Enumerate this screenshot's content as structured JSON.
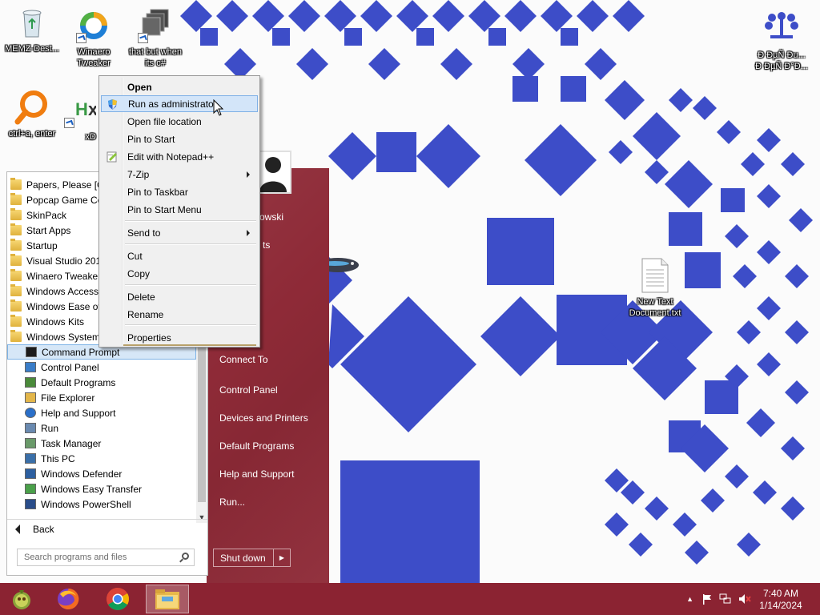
{
  "desktop": {
    "icons_left": [
      {
        "label": "MEMZ-Dest...",
        "icon": "recycle-bin-icon"
      },
      {
        "label": "Winaero Tweaker",
        "icon": "winaero-icon"
      },
      {
        "label": "that but when its c#",
        "icon": "stacked-windows-icon"
      },
      {
        "label": "ctrl+a, enter",
        "icon": "orange-magnifier-icon"
      },
      {
        "label": "xD",
        "icon": "hx-icon"
      }
    ],
    "icons_right": [
      {
        "label": "Đ ĐµÑ Đu...\nĐ ĐµÑ Đ°Đ...",
        "icon": "network-tree-icon"
      },
      {
        "label": "New Text Document.txt",
        "icon": "text-file-icon"
      }
    ]
  },
  "context_menu": {
    "items": [
      {
        "label": "Open",
        "bold": true
      },
      {
        "label": "Run as administrator",
        "hover": true,
        "icon": "uac-shield-icon"
      },
      {
        "label": "Open file location"
      },
      {
        "label": "Pin to Start"
      },
      {
        "label": "Edit with Notepad++",
        "icon": "notepad-plus-plus-icon"
      },
      {
        "label": "7-Zip",
        "submenu": true
      },
      {
        "label": "Pin to Taskbar"
      },
      {
        "label": "Pin to Start Menu"
      },
      {
        "label": "Send to",
        "submenu": true
      },
      {
        "label": "Cut"
      },
      {
        "label": "Copy"
      },
      {
        "label": "Delete"
      },
      {
        "label": "Rename"
      },
      {
        "label": "Properties"
      }
    ]
  },
  "start_menu": {
    "programs": [
      {
        "label": "Papers, Please [G",
        "type": "folder"
      },
      {
        "label": "Popcap Game Co",
        "type": "folder"
      },
      {
        "label": "SkinPack",
        "type": "folder"
      },
      {
        "label": "Start Apps",
        "type": "folder"
      },
      {
        "label": "Startup",
        "type": "folder"
      },
      {
        "label": "Visual Studio 201",
        "type": "folder"
      },
      {
        "label": "Winaero Tweaker",
        "type": "folder"
      },
      {
        "label": "Windows Accesso",
        "type": "folder"
      },
      {
        "label": "Windows Ease of",
        "type": "folder"
      },
      {
        "label": "Windows Kits",
        "type": "folder"
      },
      {
        "label": "Windows System",
        "type": "folder"
      },
      {
        "label": "Command Prompt",
        "type": "app",
        "icon": "cmd-icon",
        "selected": true
      },
      {
        "label": "Control Panel",
        "type": "app",
        "icon": "control-panel-icon"
      },
      {
        "label": "Default Programs",
        "type": "app",
        "icon": "default-programs-icon"
      },
      {
        "label": "File Explorer",
        "type": "app",
        "icon": "file-explorer-icon"
      },
      {
        "label": "Help and Support",
        "type": "app",
        "icon": "help-icon"
      },
      {
        "label": "Run",
        "type": "app",
        "icon": "run-icon"
      },
      {
        "label": "Task Manager",
        "type": "app",
        "icon": "task-manager-icon"
      },
      {
        "label": "This PC",
        "type": "app",
        "icon": "computer-icon"
      },
      {
        "label": "Windows Defender",
        "type": "app",
        "icon": "defender-icon"
      },
      {
        "label": "Windows Easy Transfer",
        "type": "app",
        "icon": "easy-transfer-icon"
      },
      {
        "label": "Windows PowerShell",
        "type": "app",
        "icon": "powershell-icon"
      }
    ],
    "back_label": "Back",
    "search_placeholder": "Search programs and files",
    "right_links": [
      {
        "label": "owski",
        "partial": true
      },
      {
        "label": "ts",
        "partial": true
      },
      {
        "label": "Connect To"
      },
      {
        "label": "Control Panel"
      },
      {
        "label": "Devices and Printers"
      },
      {
        "label": "Default Programs"
      },
      {
        "label": "Help and Support"
      },
      {
        "label": "Run..."
      }
    ],
    "shutdown_label": "Shut down"
  },
  "taskbar": {
    "pinned": [
      {
        "name": "start-orb-icon"
      },
      {
        "name": "firefox-icon"
      },
      {
        "name": "chrome-icon"
      },
      {
        "name": "file-explorer-icon",
        "active": true
      }
    ],
    "tray": {
      "time": "7:40 AM",
      "date": "1/14/2024"
    }
  },
  "colors": {
    "accent": "#8b2332",
    "wallpaper_shape": "#3d4dc8"
  }
}
